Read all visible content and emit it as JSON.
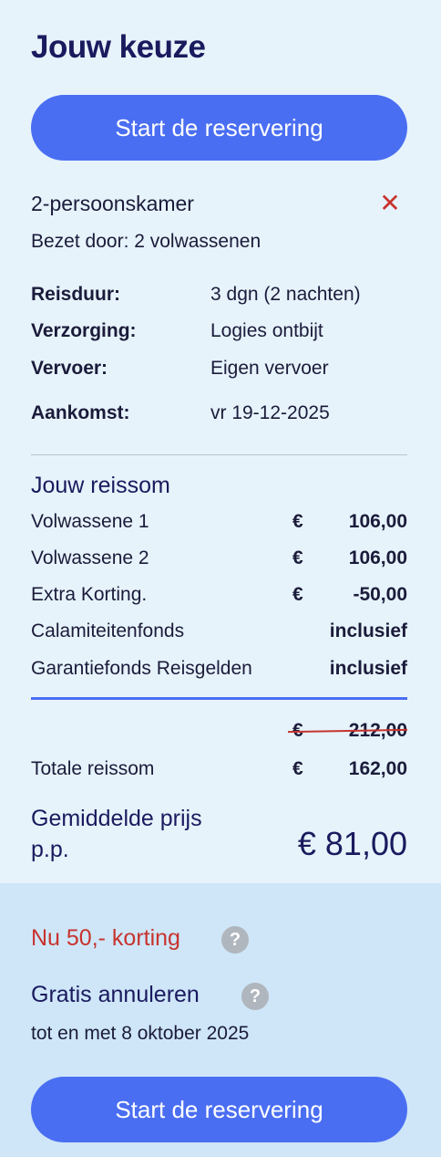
{
  "header": {
    "title": "Jouw keuze"
  },
  "buttons": {
    "start_label": "Start de reservering"
  },
  "room": {
    "name": "2-persoonskamer",
    "occupancy": "Bezet door: 2 volwassenen",
    "remove_icon": "close-icon",
    "remove_glyph": "✕"
  },
  "details": [
    {
      "label": "Reisduur:",
      "value": "3 dgn (2 nachten)"
    },
    {
      "label": "Verzorging:",
      "value": "Logies ontbijt"
    },
    {
      "label": "Vervoer:",
      "value": "Eigen vervoer"
    },
    {
      "label": "Aankomst:",
      "value": "vr 19-12-2025"
    }
  ],
  "price": {
    "title": "Jouw reissom",
    "rows": [
      {
        "label": "Volwassene 1",
        "currency": "€",
        "amount": "106,00"
      },
      {
        "label": "Volwassene 2",
        "currency": "€",
        "amount": "106,00"
      },
      {
        "label": "Extra Korting.",
        "currency": "€",
        "amount": "-50,00"
      },
      {
        "label": "Calamiteitenfonds",
        "currency": "",
        "amount": "inclusief"
      },
      {
        "label": "Garantiefonds Reisgelden",
        "currency": "",
        "amount": "inclusief"
      }
    ],
    "original_currency": "€",
    "original_amount": "212,00",
    "total_label": "Totale reissom",
    "total_currency": "€",
    "total_amount": "162,00",
    "average_label": "Gemiddelde prijs p.p.",
    "average_value": "€ 81,00"
  },
  "promo": {
    "discount_text": "Nu 50,- korting",
    "cancel_title": "Gratis annuleren",
    "cancel_until": "tot en met 8 oktober 2025",
    "help_glyph": "?"
  },
  "colors": {
    "primary": "#4a6ef2",
    "navy": "#1a1a5e",
    "red": "#c8332e",
    "panel_bg": "#e6f3fb",
    "promo_bg": "#cee6f8"
  }
}
